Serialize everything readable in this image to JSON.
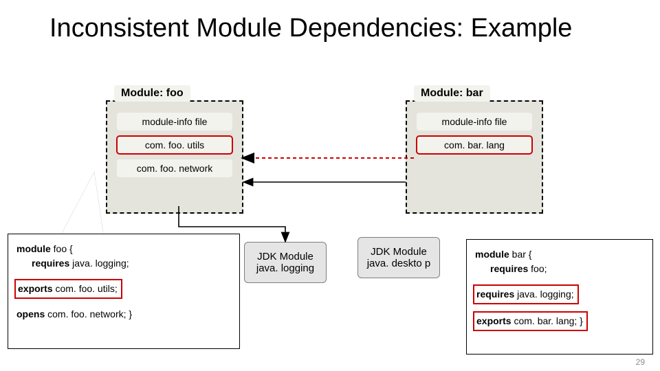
{
  "title": "Inconsistent Module Dependencies: Example",
  "foo": {
    "header": "Module: foo",
    "info": "module-info file",
    "pkg1": "com. foo. utils",
    "pkg2": "com. foo. network"
  },
  "bar": {
    "header": "Module: bar",
    "info": "module-info file",
    "pkg1": "com. bar. lang"
  },
  "jdk": {
    "logging": "JDK Module java. logging",
    "desktop": "JDK Module java. deskto p"
  },
  "code_foo": {
    "l1_kw": "module",
    "l1_rest": " foo {",
    "l2_kw": "requires",
    "l2_rest": " java. logging;",
    "l3_kw": "exports",
    "l3_rest": " com. foo. utils;",
    "l4_kw": "opens",
    "l4_rest": " com. foo. network; }"
  },
  "code_bar": {
    "l1_kw": "module",
    "l1_rest": " bar {",
    "l2_kw": "requires",
    "l2_rest": " foo;",
    "l3_kw": "requires",
    "l3_rest": " java. logging;",
    "l4_kw": "exports",
    "l4_rest": " com. bar. lang; }"
  },
  "page": "29"
}
